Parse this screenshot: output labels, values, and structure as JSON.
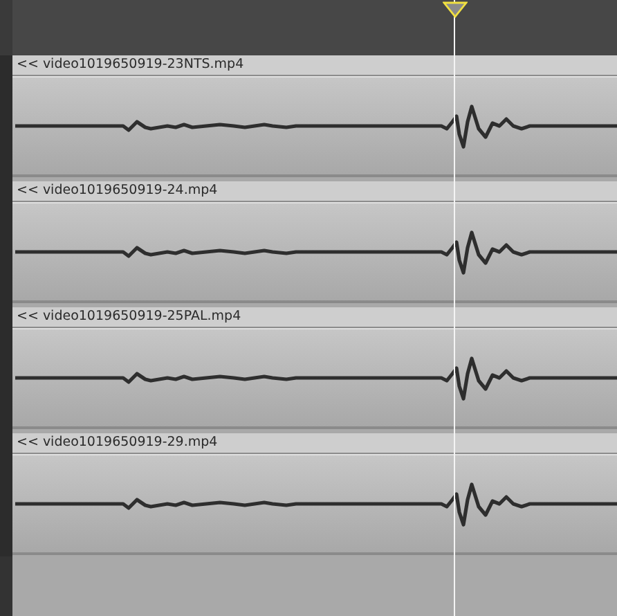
{
  "clips": [
    {
      "label": "<< video1019650919-23NTS.mp4"
    },
    {
      "label": "<< video1019650919-24.mp4"
    },
    {
      "label": "<< video1019650919-25PAL.mp4"
    },
    {
      "label": "<< video1019650919-29.mp4"
    }
  ]
}
